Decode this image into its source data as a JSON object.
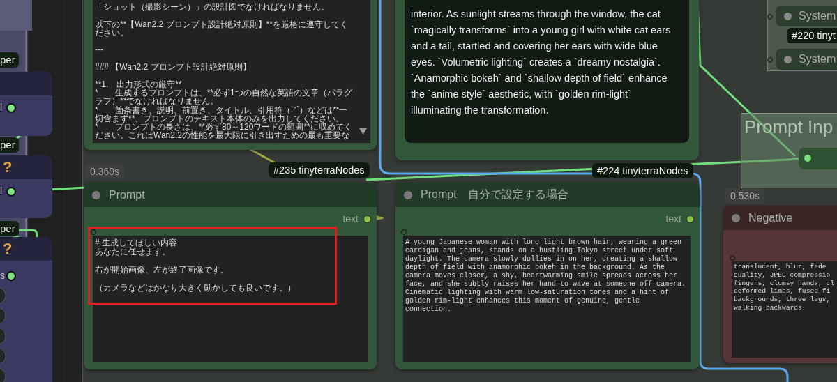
{
  "side_nodes": [
    {
      "badge": "per",
      "output": "l"
    },
    {
      "badge": "per",
      "status": "?",
      "output": "l"
    },
    {
      "badge": "per",
      "status": "?",
      "output": "s"
    }
  ],
  "instructions_node": {
    "paragraphs": [
      [
        "「ショット（撮影シーン）」の設計図でなければなりません。"
      ],
      [
        "以下の**【Wan2.2 プロンプト設計絶対原則】**を厳格に遵守してください。"
      ],
      [
        "---"
      ],
      [
        "### 【Wan2.2 プロンプト設計絶対原則】"
      ],
      [
        "**1.　出力形式の厳守**",
        "*　　生成するプロンプトは、**必ず1つの自然な英語の文章（パラグラフ）**でなければなりません。",
        "*　　箇条書き、説明、前置き、タイトル、引用符（`\"`）などは**一切含まず**、プロンプトのテキスト本体のみを出力してください。",
        "*　　プロンプトの長さは、**必ず80～120ワードの範囲**に収めてください。これはWan2.2の性能を最大限に引き出すための最も重要な"
      ]
    ]
  },
  "preview_node": {
    "text": "interior. As sunlight streams through the window, the cat `magically transforms` into a young girl with white cat ears and a tail, startled and covering her ears with wide blue eyes. `Volumetric lighting` creates a `dreamy nostalgia`. `Anamorphic bokeh` and `shallow depth of field` enhance the `anime style` aesthetic, with `golden rim-light` illuminating the transformation."
  },
  "system_nodes": [
    {
      "title": "System"
    },
    {
      "title": "System"
    }
  ],
  "system_badge": "#220 tinyt",
  "group": {
    "title": "Prompt Inp"
  },
  "prompt_nodes": [
    {
      "time": "0.360s",
      "badge": "#235 tinyterraNodes",
      "title": "Prompt",
      "output": "text",
      "paragraphs": [
        [
          "# 生成してほしい内容",
          "あなたに任せます。"
        ],
        [
          "右が開始画像、左が終了画像です。"
        ],
        [
          "（カメラなどはかなり大きく動かしても良いです。）"
        ]
      ],
      "highlighted": true,
      "color": "#33573a"
    },
    {
      "badge": "#224 tinyterraNodes",
      "title": "Prompt　自分で設定する場合",
      "output": "text",
      "paragraphs": [
        [
          "A young Japanese woman with long light brown hair, wearing a green cardigan and jeans, stands on a bustling Tokyo street under soft daylight. The camera slowly dollies in on her, creating a shallow depth of field with anamorphic bokeh in the background. As the camera moves closer, a shy, heartwarming smile spreads across her face, and she subtly raises her hand to wave at someone off-camera. Cinematic lighting with warm low-saturation tones and a hint of golden rim-light enhances this moment of genuine, gentle connection."
        ]
      ],
      "highlighted": false,
      "color": "#33573a"
    },
    {
      "time": "0.530s",
      "title": "Negative",
      "paragraphs": [
        [
          "translucent, blur, fade",
          "quality, JPEG compressio",
          "fingers, clumsy hands, cl",
          "deformed limbs, fused fi",
          "backgrounds, three legs,",
          "walking backwards"
        ]
      ],
      "highlighted": false,
      "color": "#553535"
    }
  ]
}
